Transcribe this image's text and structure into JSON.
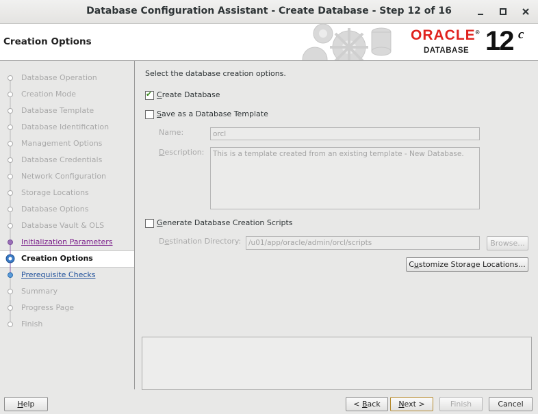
{
  "window": {
    "title": "Database Configuration Assistant - Create Database - Step 12 of 16",
    "minimize_glyph": "✕",
    "controls": {
      "minimize": "minimize-icon",
      "maximize": "maximize-icon",
      "close": "close-icon"
    }
  },
  "header": {
    "page_title": "Creation Options",
    "brand": "ORACLE",
    "brand_trademark": "®",
    "product": "DATABASE",
    "version": "12",
    "version_suffix": "c"
  },
  "colors": {
    "oracle_red": "#e0231e",
    "visited_link": "#7a1e8a",
    "link": "#1e4f9a",
    "check": "#3b8a1f"
  },
  "steps": [
    {
      "label": "Database Operation",
      "state": "disabled"
    },
    {
      "label": "Creation Mode",
      "state": "disabled"
    },
    {
      "label": "Database Template",
      "state": "disabled"
    },
    {
      "label": "Database Identification",
      "state": "disabled"
    },
    {
      "label": "Management Options",
      "state": "disabled"
    },
    {
      "label": "Database Credentials",
      "state": "disabled"
    },
    {
      "label": "Network Configuration",
      "state": "disabled"
    },
    {
      "label": "Storage Locations",
      "state": "disabled"
    },
    {
      "label": "Database Options",
      "state": "disabled"
    },
    {
      "label": "Database Vault & OLS",
      "state": "disabled"
    },
    {
      "label": "Initialization Parameters",
      "state": "visited-link"
    },
    {
      "label": "Creation Options",
      "state": "current"
    },
    {
      "label": "Prerequisite Checks",
      "state": "link"
    },
    {
      "label": "Summary",
      "state": "disabled"
    },
    {
      "label": "Progress Page",
      "state": "disabled"
    },
    {
      "label": "Finish",
      "state": "disabled"
    }
  ],
  "main": {
    "intro": "Select the database creation options.",
    "create_db": {
      "mnemonic": "C",
      "rest": "reate Database",
      "checked": true
    },
    "save_template": {
      "mnemonic": "S",
      "rest": "ave as a Database Template",
      "checked": false
    },
    "name_label": "Name:",
    "name_value": "orcl",
    "description_label": "Description:",
    "description_mnemonic": "D",
    "description_rest": "escription:",
    "description_value": "This is a template created from an existing template - New Database.",
    "gen_scripts": {
      "mnemonic": "G",
      "rest": "enerate Database Creation Scripts",
      "checked": false
    },
    "dest_label_pre": "D",
    "dest_label_mnemonic": "e",
    "dest_label_rest": "stination Directory:",
    "dest_value": "/u01/app/oracle/admin/orcl/scripts",
    "browse_label": "Browse...",
    "customize_pre": "C",
    "customize_mnemonic": "u",
    "customize_rest": "stomize Storage Locations..."
  },
  "footer": {
    "help": "Help",
    "help_mnemonic": "H",
    "help_rest": "elp",
    "back_pre": "< ",
    "back_mnemonic": "B",
    "back_rest": "ack",
    "next_mnemonic": "N",
    "next_rest": "ext >",
    "finish": "Finish",
    "cancel": "Cancel"
  }
}
